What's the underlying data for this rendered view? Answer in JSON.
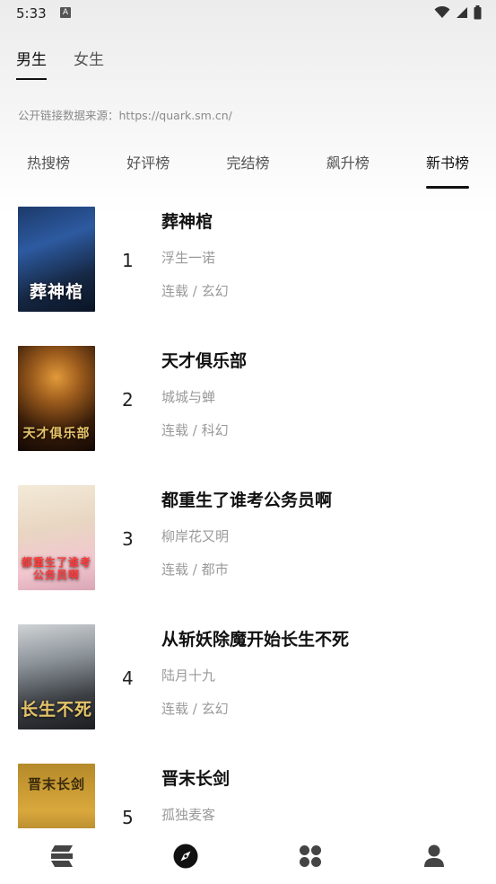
{
  "status": {
    "time": "5:33",
    "badge": "A"
  },
  "gender_tabs": [
    {
      "label": "男生",
      "active": true
    },
    {
      "label": "女生",
      "active": false
    }
  ],
  "source_note": "公开链接数据来源：https://quark.sm.cn/",
  "rank_tabs": [
    {
      "label": "热搜榜",
      "active": false
    },
    {
      "label": "好评榜",
      "active": false
    },
    {
      "label": "完结榜",
      "active": false
    },
    {
      "label": "飙升榜",
      "active": false
    },
    {
      "label": "新书榜",
      "active": true
    }
  ],
  "books": [
    {
      "rank": "1",
      "title": "葬神棺",
      "author": "浮生一诺",
      "meta": "连载 / 玄幻",
      "cover_text": "葬神棺"
    },
    {
      "rank": "2",
      "title": "天才俱乐部",
      "author": "城城与蝉",
      "meta": "连载 / 科幻",
      "cover_text": "天才俱乐部"
    },
    {
      "rank": "3",
      "title": "都重生了谁考公务员啊",
      "author": "柳岸花又明",
      "meta": "连载 / 都市",
      "cover_text": "都重生了谁考公务员啊"
    },
    {
      "rank": "4",
      "title": "从斩妖除魔开始长生不死",
      "author": "陆月十九",
      "meta": "连载 / 玄幻",
      "cover_text": "长生不死"
    },
    {
      "rank": "5",
      "title": "晋末长剑",
      "author": "孤独麦客",
      "meta": "",
      "cover_text": "晋末长剑"
    }
  ],
  "bottom_nav": [
    {
      "icon": "bookshelf-icon",
      "active": false
    },
    {
      "icon": "compass-icon",
      "active": true
    },
    {
      "icon": "category-grid-icon",
      "active": false
    },
    {
      "icon": "profile-icon",
      "active": false
    }
  ]
}
